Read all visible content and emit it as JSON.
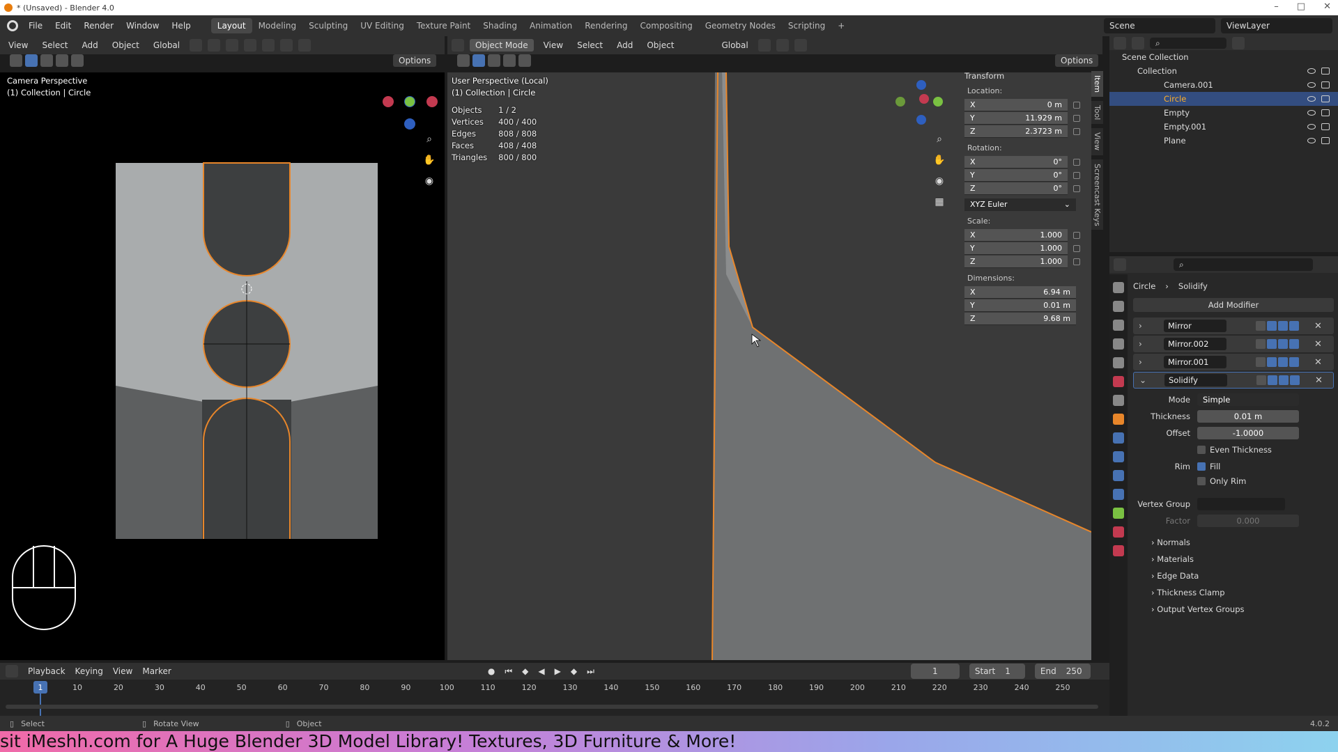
{
  "titlebar": {
    "title": "* (Unsaved) - Blender 4.0"
  },
  "menu": {
    "items": [
      "File",
      "Edit",
      "Render",
      "Window",
      "Help"
    ]
  },
  "workspaces": [
    "Layout",
    "Modeling",
    "Sculpting",
    "UV Editing",
    "Texture Paint",
    "Shading",
    "Animation",
    "Rendering",
    "Compositing",
    "Geometry Nodes",
    "Scripting"
  ],
  "active_workspace": "Layout",
  "scene": {
    "name": "Scene",
    "view_layer": "ViewLayer"
  },
  "left_view": {
    "header_menus": [
      "View",
      "Select",
      "Add",
      "Object"
    ],
    "orientation": "Global",
    "options": "Options",
    "overlay_title": "Camera Perspective",
    "overlay_sub": "(1) Collection | Circle"
  },
  "main_view": {
    "mode": "Object Mode",
    "header_menus": [
      "View",
      "Select",
      "Add",
      "Object"
    ],
    "orientation": "Global",
    "options": "Options",
    "overlay_title": "User Perspective (Local)",
    "overlay_sub": "(1) Collection | Circle",
    "stats": [
      {
        "label": "Objects",
        "value": "1 / 2"
      },
      {
        "label": "Vertices",
        "value": "400 / 400"
      },
      {
        "label": "Edges",
        "value": "808 / 808"
      },
      {
        "label": "Faces",
        "value": "408 / 408"
      },
      {
        "label": "Triangles",
        "value": "800 / 800"
      }
    ]
  },
  "transform": {
    "title": "Transform",
    "location_label": "Location:",
    "location": [
      {
        "axis": "X",
        "value": "0 m"
      },
      {
        "axis": "Y",
        "value": "11.929 m"
      },
      {
        "axis": "Z",
        "value": "2.3723 m"
      }
    ],
    "rotation_label": "Rotation:",
    "rotation": [
      {
        "axis": "X",
        "value": "0°"
      },
      {
        "axis": "Y",
        "value": "0°"
      },
      {
        "axis": "Z",
        "value": "0°"
      }
    ],
    "rotation_mode": "XYZ Euler",
    "scale_label": "Scale:",
    "scale": [
      {
        "axis": "X",
        "value": "1.000"
      },
      {
        "axis": "Y",
        "value": "1.000"
      },
      {
        "axis": "Z",
        "value": "1.000"
      }
    ],
    "dimensions_label": "Dimensions:",
    "dimensions": [
      {
        "axis": "X",
        "value": "6.94 m"
      },
      {
        "axis": "Y",
        "value": "0.01 m"
      },
      {
        "axis": "Z",
        "value": "9.68 m"
      }
    ]
  },
  "side_tabs": [
    "Item",
    "Tool",
    "View",
    "Screencast Keys"
  ],
  "outliner": {
    "root": "Scene Collection",
    "collection": "Collection",
    "items": [
      "Camera.001",
      "Circle",
      "Empty",
      "Empty.001",
      "Plane"
    ],
    "selected": "Circle"
  },
  "properties": {
    "breadcrumb_object": "Circle",
    "breadcrumb_modifier": "Solidify",
    "add_modifier": "Add Modifier",
    "modifiers": [
      "Mirror",
      "Mirror.002",
      "Mirror.001",
      "Solidify"
    ],
    "solidify": {
      "mode_label": "Mode",
      "mode": "Simple",
      "thickness_label": "Thickness",
      "thickness": "0.01 m",
      "offset_label": "Offset",
      "offset": "-1.0000",
      "even_thickness": "Even Thickness",
      "rim_label": "Rim",
      "fill": "Fill",
      "only_rim": "Only Rim",
      "vertex_group_label": "Vertex Group",
      "factor_label": "Factor",
      "factor": "0.000",
      "subpanels": [
        "Normals",
        "Materials",
        "Edge Data",
        "Thickness Clamp",
        "Output Vertex Groups"
      ]
    }
  },
  "timeline": {
    "menus": [
      "Playback",
      "Keying",
      "View",
      "Marker"
    ],
    "current_frame": "1",
    "start_label": "Start",
    "start": "1",
    "end_label": "End",
    "end": "250",
    "ticks": [
      "1",
      "10",
      "20",
      "30",
      "40",
      "50",
      "60",
      "70",
      "80",
      "90",
      "100",
      "110",
      "120",
      "130",
      "140",
      "150",
      "160",
      "170",
      "180",
      "190",
      "200",
      "210",
      "220",
      "230",
      "240",
      "250"
    ]
  },
  "statusbar": {
    "select": "Select",
    "rotate": "Rotate View",
    "object": "Object",
    "version": "4.0.2"
  },
  "banner": {
    "text": "sit iMeshh.com for A Huge Blender 3D Model Library! Textures, 3D Furniture & More!"
  },
  "colors": {
    "accent": "#4772b3",
    "selection": "#e8862a",
    "header": "#303030"
  }
}
